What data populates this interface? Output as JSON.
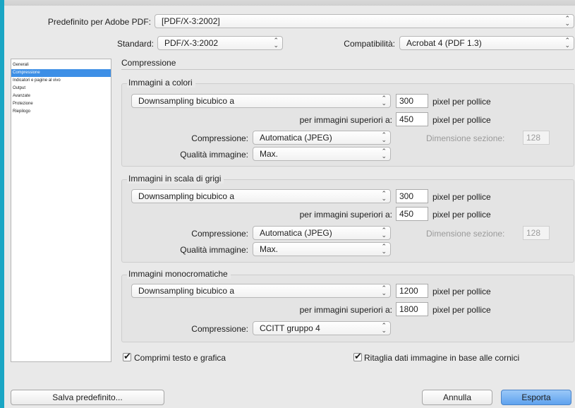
{
  "preset": {
    "label": "Predefinito per Adobe PDF:",
    "value": "[PDF/X-3:2002]"
  },
  "standard": {
    "label": "Standard:",
    "value": "PDF/X-3:2002"
  },
  "compat": {
    "label": "Compatibilità:",
    "value": "Acrobat 4 (PDF 1.3)"
  },
  "sidebar": {
    "items": [
      {
        "label": "Generali"
      },
      {
        "label": "Compressione"
      },
      {
        "label": "Indicatori e pagine al vivo"
      },
      {
        "label": "Output"
      },
      {
        "label": "Avanzate"
      },
      {
        "label": "Protezione"
      },
      {
        "label": "Riepilogo"
      }
    ]
  },
  "section_title": "Compressione",
  "color_images": {
    "title": "Immagini a colori",
    "sampling": "Downsampling bicubico a",
    "ppi": "300",
    "ppi_unit": "pixel per pollice",
    "above_label": "per immagini superiori a:",
    "above": "450",
    "above_unit": "pixel per pollice",
    "compression_label": "Compressione:",
    "compression": "Automatica (JPEG)",
    "tile_label": "Dimensione sezione:",
    "tile": "128",
    "quality_label": "Qualità immagine:",
    "quality": "Max."
  },
  "gray_images": {
    "title": "Immagini in scala di grigi",
    "sampling": "Downsampling bicubico a",
    "ppi": "300",
    "ppi_unit": "pixel per pollice",
    "above_label": "per immagini superiori a:",
    "above": "450",
    "above_unit": "pixel per pollice",
    "compression_label": "Compressione:",
    "compression": "Automatica (JPEG)",
    "tile_label": "Dimensione sezione:",
    "tile": "128",
    "quality_label": "Qualità immagine:",
    "quality": "Max."
  },
  "mono_images": {
    "title": "Immagini monocromatiche",
    "sampling": "Downsampling bicubico a",
    "ppi": "1200",
    "ppi_unit": "pixel per pollice",
    "above_label": "per immagini superiori a:",
    "above": "1800",
    "above_unit": "pixel per pollice",
    "compression_label": "Compressione:",
    "compression": "CCITT gruppo 4"
  },
  "options": {
    "compress_text": "Comprimi testo e grafica",
    "crop_images": "Ritaglia dati immagine in base alle cornici"
  },
  "buttons": {
    "save_preset": "Salva predefinito...",
    "cancel": "Annulla",
    "export": "Esporta"
  },
  "colors": {
    "accent": "#3d8fe6",
    "background": "#1aa6c4",
    "dialog": "#e9e9e9"
  },
  "icons": {
    "select_arrows": "⌃⌄",
    "check": "✔"
  }
}
